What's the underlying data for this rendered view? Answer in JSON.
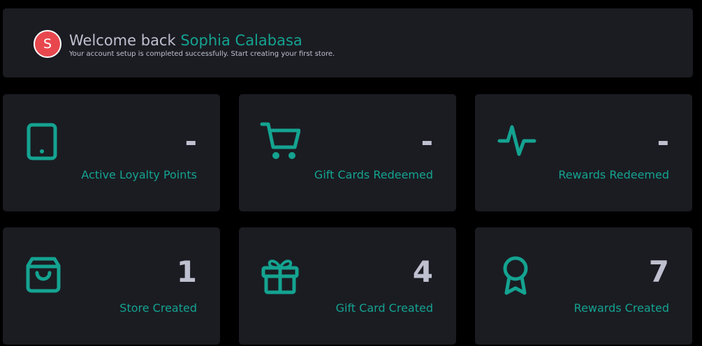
{
  "welcome": {
    "avatar_initial": "S",
    "greeting": "Welcome back",
    "user_name": "Sophia Calabasa",
    "subtitle": "Your account setup is completed successfully. Start creating your first store."
  },
  "stats": [
    {
      "icon": "tablet-icon",
      "value": "-",
      "label": "Active Loyalty Points"
    },
    {
      "icon": "cart-icon",
      "value": "-",
      "label": "Gift Cards Redeemed"
    },
    {
      "icon": "activity-icon",
      "value": "-",
      "label": "Rewards Redeemed"
    },
    {
      "icon": "shopping-bag-icon",
      "value": "1",
      "label": "Store Created"
    },
    {
      "icon": "gift-icon",
      "value": "4",
      "label": "Gift Card Created"
    },
    {
      "icon": "award-icon",
      "value": "7",
      "label": "Rewards Created"
    }
  ],
  "colors": {
    "background": "#000000",
    "card": "#1b1c22",
    "accent": "#14a391",
    "text": "#bfc0cf",
    "avatar": "#e8474e"
  }
}
